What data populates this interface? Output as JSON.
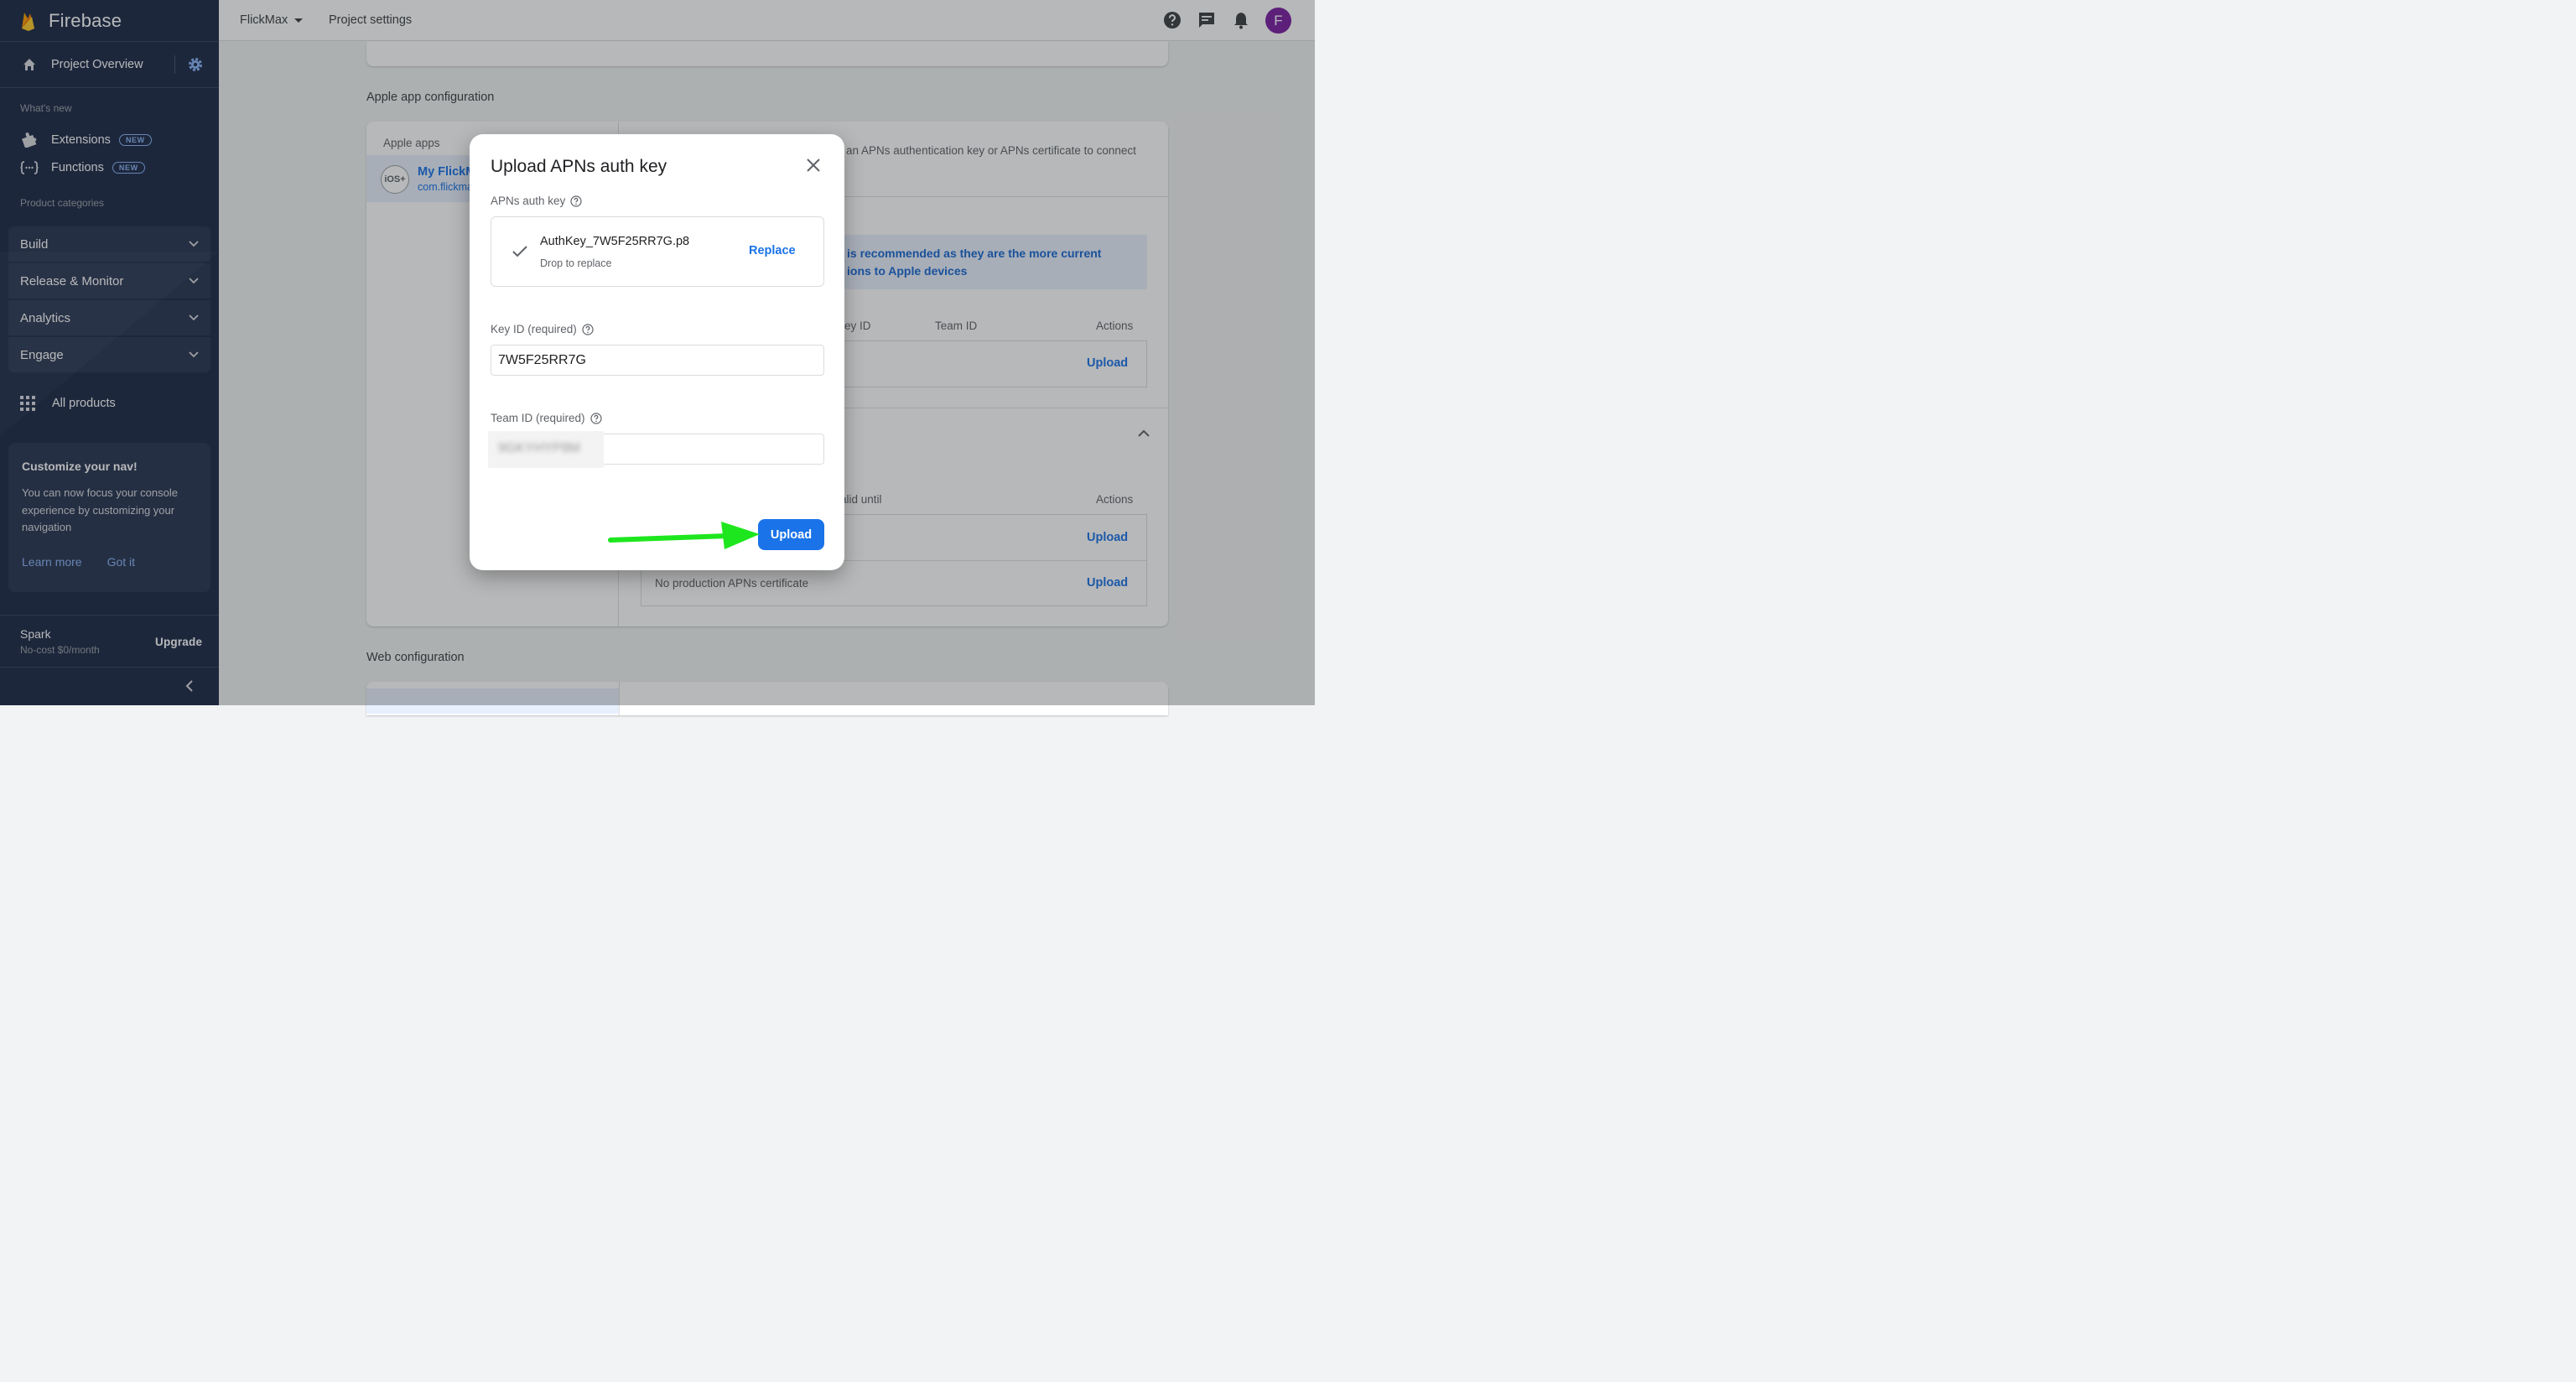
{
  "sidebar": {
    "brand": "Firebase",
    "overview": "Project Overview",
    "whats_new": "What's new",
    "items": [
      {
        "label": "Extensions",
        "badge": "NEW",
        "icon": "puzzle-icon"
      },
      {
        "label": "Functions",
        "badge": "NEW",
        "icon": "functions-icon"
      }
    ],
    "product_categories": "Product categories",
    "categories": [
      "Build",
      "Release & Monitor",
      "Analytics",
      "Engage"
    ],
    "all_products": "All products",
    "promo": {
      "title": "Customize your nav!",
      "body": "You can now focus your console experience by customizing your navigation",
      "learn_more": "Learn more",
      "got_it": "Got it"
    },
    "plan": {
      "name": "Spark",
      "sub": "No-cost $0/month",
      "upgrade": "Upgrade"
    }
  },
  "topbar": {
    "project": "FlickMax",
    "page": "Project settings",
    "avatar_letter": "F"
  },
  "main": {
    "apple_section_title": "Apple app configuration",
    "apple_apps_header": "Apple apps",
    "app_name": "My FlickM",
    "app_bundle": "com.flickma",
    "app_badge": "iOS+",
    "intro_text": "an APNs authentication key or APNs certificate to connect",
    "info_line1": "is recommended as they are the more current",
    "info_line2": "ions to Apple devices",
    "auth_cols": {
      "key_id": "ey ID",
      "team_id": "Team ID",
      "actions": "Actions"
    },
    "cert_cols": {
      "valid_until": "alid until",
      "actions": "Actions"
    },
    "upload_label": "Upload",
    "no_prod_cert": "No production APNs certificate",
    "web_section_title": "Web configuration"
  },
  "dialog": {
    "title": "Upload APNs auth key",
    "auth_key_label": "APNs auth key",
    "file_name": "AuthKey_7W5F25RR7G.p8",
    "drop_hint": "Drop to replace",
    "replace_label": "Replace",
    "key_id_label": "Key ID (required)",
    "key_id_value": "7W5F25RR7G",
    "team_id_label": "Team ID (required)",
    "team_id_value": "",
    "team_id_blurred": "9GKYHYP8M",
    "upload_label": "Upload"
  },
  "colors": {
    "sidebar_bg": "#1c2a48",
    "accent": "#1a73e8",
    "avatar": "#7b1fa2",
    "arrow": "#1ee61e"
  }
}
